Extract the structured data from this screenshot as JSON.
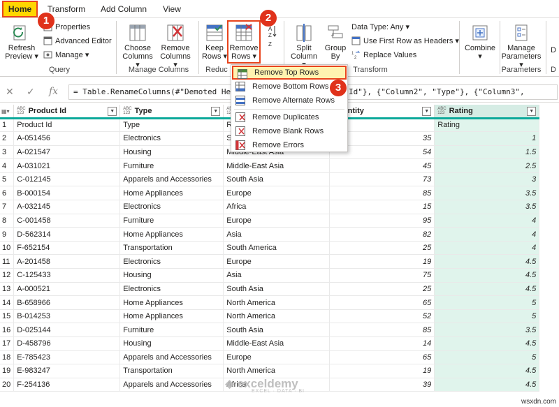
{
  "tabs": [
    "Home",
    "Transform",
    "Add Column",
    "View"
  ],
  "ribbon": {
    "refresh_preview": "Refresh Preview",
    "properties": "Properties",
    "advanced_editor": "Advanced Editor",
    "manage": "Manage",
    "choose_columns": "Choose Columns",
    "remove_columns": "Remove Columns",
    "keep_rows": "Keep Rows",
    "remove_rows": "Remove Rows",
    "split_column": "Split Column",
    "group_by": "Group By",
    "data_type": "Data Type: Any",
    "use_first_row": "Use First Row as Headers",
    "replace_values": "Replace Values",
    "combine": "Combine",
    "manage_parameters": "Manage Parameters",
    "groups": {
      "query": "Query",
      "manage_columns": "Manage Columns",
      "reduce": "Reduc",
      "transform": "Transform",
      "parameters": "Parameters",
      "cut_letter": "D"
    },
    "cut_d": "D"
  },
  "formula": {
    "text": "= Table.RenameColumns(#\"Demoted Head",
    "tail": "Id\"}, {\"Column2\", \"Type\"}, {\"Column3\","
  },
  "menu": {
    "items": [
      "Remove Top Rows",
      "Remove Bottom Rows",
      "Remove Alternate Rows",
      "Remove Duplicates",
      "Remove Blank Rows",
      "Remove Errors"
    ]
  },
  "badges": [
    "1",
    "2",
    "3"
  ],
  "table": {
    "type_tag": "ABC\n123",
    "headers": [
      "Product Id",
      "Type",
      "R",
      "Quantity",
      "Rating"
    ],
    "rows": [
      [
        "1",
        "Product Id",
        "Type",
        "R",
        "tity",
        "Rating"
      ],
      [
        "2",
        "A-051456",
        "Electronics",
        "So",
        "35",
        "1"
      ],
      [
        "3",
        "A-021547",
        "Housing",
        "Middle-East Asia",
        "54",
        "1.5"
      ],
      [
        "4",
        "A-031021",
        "Furniture",
        "Middle-East Asia",
        "45",
        "2.5"
      ],
      [
        "5",
        "C-012145",
        "Apparels and Accessories",
        "South Asia",
        "73",
        "3"
      ],
      [
        "6",
        "B-000154",
        "Home Appliances",
        "Europe",
        "85",
        "3.5"
      ],
      [
        "7",
        "A-032145",
        "Electronics",
        "Africa",
        "15",
        "3.5"
      ],
      [
        "8",
        "C-001458",
        "Furniture",
        "Europe",
        "95",
        "4"
      ],
      [
        "9",
        "D-562314",
        "Home Appliances",
        "Asia",
        "82",
        "4"
      ],
      [
        "10",
        "F-652154",
        "Transportation",
        "South America",
        "25",
        "4"
      ],
      [
        "11",
        "A-201458",
        "Electronics",
        "Europe",
        "19",
        "4.5"
      ],
      [
        "12",
        "C-125433",
        "Housing",
        "Asia",
        "75",
        "4.5"
      ],
      [
        "13",
        "A-000521",
        "Electronics",
        "South Asia",
        "25",
        "4.5"
      ],
      [
        "14",
        "B-658966",
        "Home Appliances",
        "North America",
        "65",
        "5"
      ],
      [
        "15",
        "B-014253",
        "Home Appliances",
        "North America",
        "52",
        "5"
      ],
      [
        "16",
        "D-025144",
        "Furniture",
        "South Asia",
        "85",
        "3.5"
      ],
      [
        "17",
        "D-458796",
        "Housing",
        "Middle-East Asia",
        "14",
        "4.5"
      ],
      [
        "18",
        "E-785423",
        "Apparels and Accessories",
        "Europe",
        "65",
        "5"
      ],
      [
        "19",
        "E-983247",
        "Transportation",
        "North America",
        "19",
        "4.5"
      ],
      [
        "20",
        "F-254136",
        "Apparels and Accessories",
        "Africa",
        "39",
        "4.5"
      ]
    ]
  },
  "watermark": {
    "name": "exceldemy",
    "sub": "EXCEL · DATA · BI"
  },
  "site": "wsxdn.com"
}
